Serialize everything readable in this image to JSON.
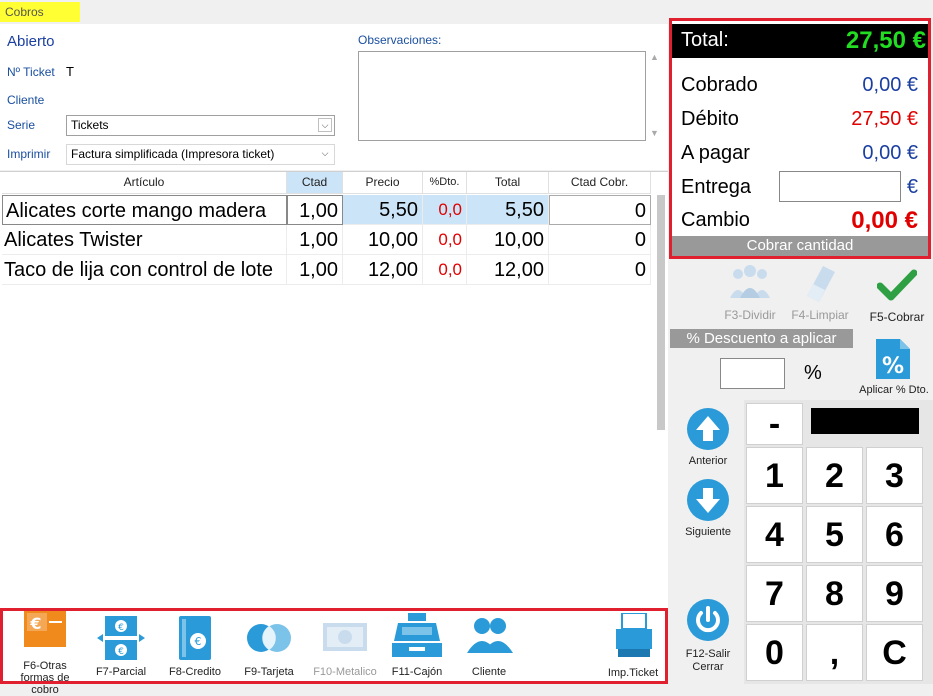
{
  "window": {
    "tab_title": "Cobros"
  },
  "header": {
    "status": "Abierto",
    "ticket_label": "Nº Ticket",
    "ticket_value": "T",
    "cliente_label": "Cliente",
    "serie_label": "Serie",
    "serie_value": "Tickets",
    "imprimir_label": "Imprimir",
    "imprimir_value": "Factura simplificada (Impresora ticket)",
    "observaciones_label": "Observaciones:",
    "observaciones_value": ""
  },
  "grid": {
    "columns": [
      "Artículo",
      "Ctad",
      "Precio",
      "%Dto.",
      "Total",
      "Ctad Cobr."
    ],
    "rows": [
      [
        "Alicates corte mango madera",
        "1,00",
        "5,50",
        "0,0",
        "5,50",
        "0"
      ],
      [
        "Alicates Twister",
        "1,00",
        "10,00",
        "0,0",
        "10,00",
        "0"
      ],
      [
        "Taco de lija con control de lote",
        "1,00",
        "12,00",
        "0,0",
        "12,00",
        "0"
      ]
    ]
  },
  "totals": {
    "total_label": "Total:",
    "total_value": "27,50 €",
    "cobrado_label": "Cobrado",
    "cobrado_value": "0,00 €",
    "debito_label": "Débito",
    "debito_value": "27,50 €",
    "apagar_label": "A pagar",
    "apagar_value": "0,00 €",
    "entrega_label": "Entrega",
    "entrega_value": "",
    "entrega_currency": "€",
    "cambio_label": "Cambio",
    "cambio_value": "0,00 €",
    "cobrar_cantidad": "Cobrar cantidad"
  },
  "actions": {
    "dividir": "F3-Dividir",
    "limpiar": "F4-Limpiar",
    "cobrar": "F5-Cobrar",
    "descuento_header": "% Descuento a aplicar",
    "descuento_value": "",
    "percent_sign": "%",
    "aplicar_dto": "Aplicar % Dto.",
    "anterior": "Anterior",
    "siguiente": "Siguiente",
    "salir_line1": "F12-Salir",
    "salir_line2": "Cerrar"
  },
  "numpad": {
    "keys": [
      "-",
      "1",
      "2",
      "3",
      "4",
      "5",
      "6",
      "7",
      "8",
      "9",
      "0",
      ",",
      "C"
    ],
    "display": ""
  },
  "bottom": {
    "otras_line1": "F6-Otras",
    "otras_line2": "formas de cobro",
    "parcial": "F7-Parcial",
    "credito": "F8-Credito",
    "tarjeta": "F9-Tarjeta",
    "metalico": "F10-Metalico",
    "cajon": "F11-Cajón",
    "cliente": "Cliente",
    "imp_ticket": "Imp.Ticket"
  },
  "colors": {
    "accent_blue": "#2a9ad8",
    "total_green": "#22dd22",
    "debit_red": "#e00000",
    "highlight_red_border": "#e0202e",
    "money_blue": "#1a3fa0",
    "tab_yellow": "#ffff33"
  }
}
